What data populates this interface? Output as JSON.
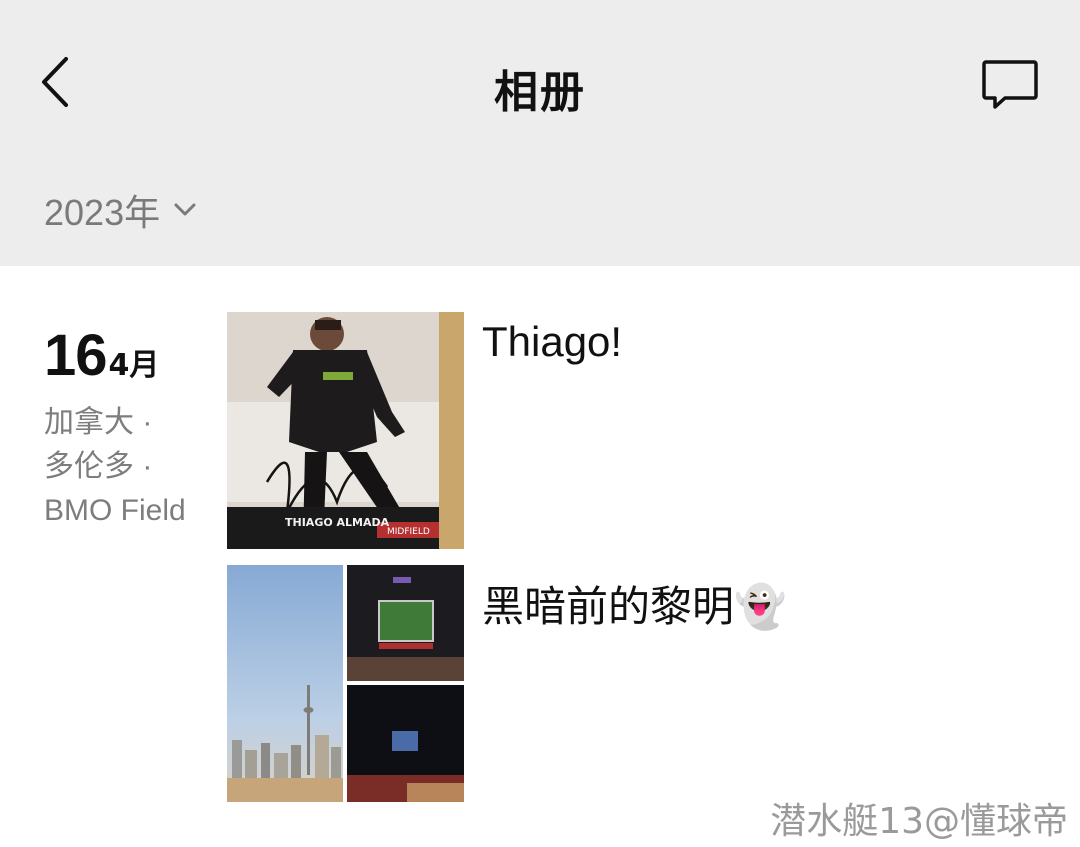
{
  "header": {
    "title": "相册",
    "back_icon": "chevron-left-icon",
    "message_icon": "message-bubble-icon"
  },
  "year_selector": {
    "label": "2023年",
    "icon": "chevron-down-icon"
  },
  "entry": {
    "day": "16",
    "month": "4月",
    "location": [
      "加拿大 ·",
      "多伦多 ·",
      "BMO Field"
    ],
    "posts": [
      {
        "text": "Thiago!",
        "card_text": "THIAGO ALMADA",
        "card_badge": "MIDFIELD"
      },
      {
        "text": "黑暗前的黎明👻"
      }
    ]
  },
  "watermark": "潜水艇13@懂球帝",
  "colors": {
    "header_bg": "#ededed",
    "body_bg": "#ffffff",
    "muted_text": "#7d7d7d"
  }
}
